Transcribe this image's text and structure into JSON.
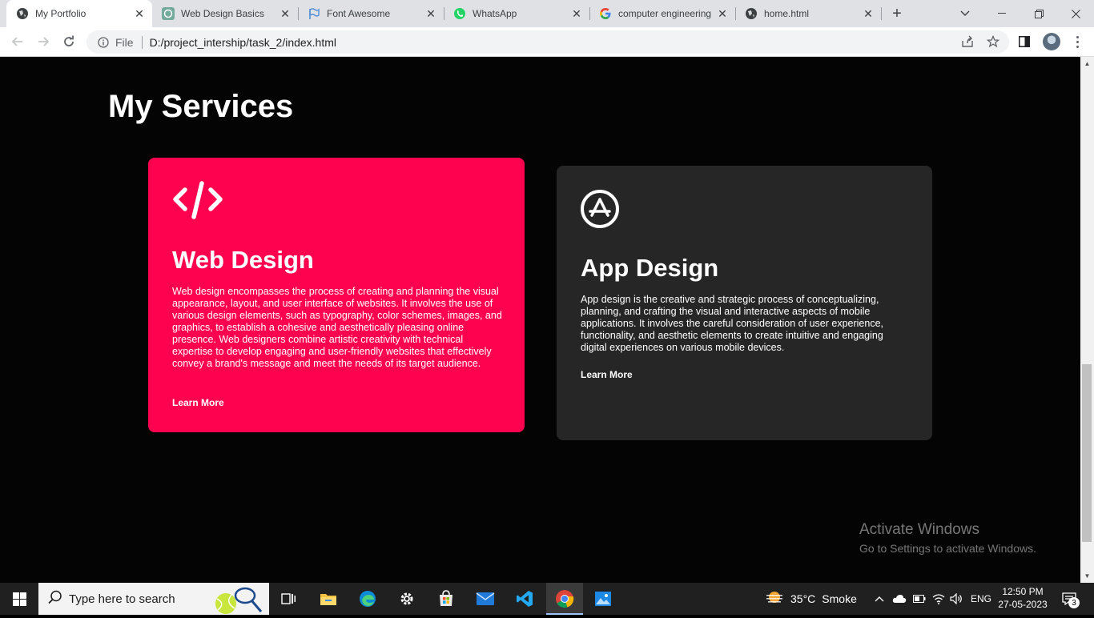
{
  "browser": {
    "tabs": [
      {
        "title": "My Portfolio",
        "active": true
      },
      {
        "title": "Web Design Basics",
        "active": false
      },
      {
        "title": "Font Awesome",
        "active": false
      },
      {
        "title": "WhatsApp",
        "active": false
      },
      {
        "title": "computer engineering",
        "active": false
      },
      {
        "title": "home.html",
        "active": false
      }
    ],
    "new_tab": "+",
    "address": {
      "scheme_label": "File",
      "url": "D:/project_intership/task_2/index.html"
    }
  },
  "page": {
    "heading": "My Services",
    "cards": [
      {
        "icon": "code-icon",
        "title": "Web Design",
        "description": "Web design encompasses the process of creating and planning the visual appearance, layout, and user interface of websites. It involves the use of various design elements, such as typography, color schemes, images, and graphics, to establish a cohesive and aesthetically pleasing online presence. Web designers combine artistic creativity with technical expertise to develop engaging and user-friendly websites that effectively convey a brand's message and meet the needs of its target audience.",
        "link": "Learn More",
        "color": "#fe0250"
      },
      {
        "icon": "app-store-icon",
        "title": "App Design",
        "description": "App design is the creative and strategic process of conceptualizing, planning, and crafting the visual and interactive aspects of mobile applications. It involves the careful consideration of user experience, functionality, and aesthetic elements to create intuitive and engaging digital experiences on various mobile devices.",
        "link": "Learn More",
        "color": "#262626"
      }
    ],
    "watermark": {
      "line1": "Activate Windows",
      "line2": "Go to Settings to activate Windows."
    }
  },
  "taskbar": {
    "search_placeholder": "Type here to search",
    "weather": {
      "temp": "35°C",
      "condition": "Smoke"
    },
    "language": "ENG",
    "time": "12:50 PM",
    "date": "27-05-2023",
    "notifications": "3"
  }
}
